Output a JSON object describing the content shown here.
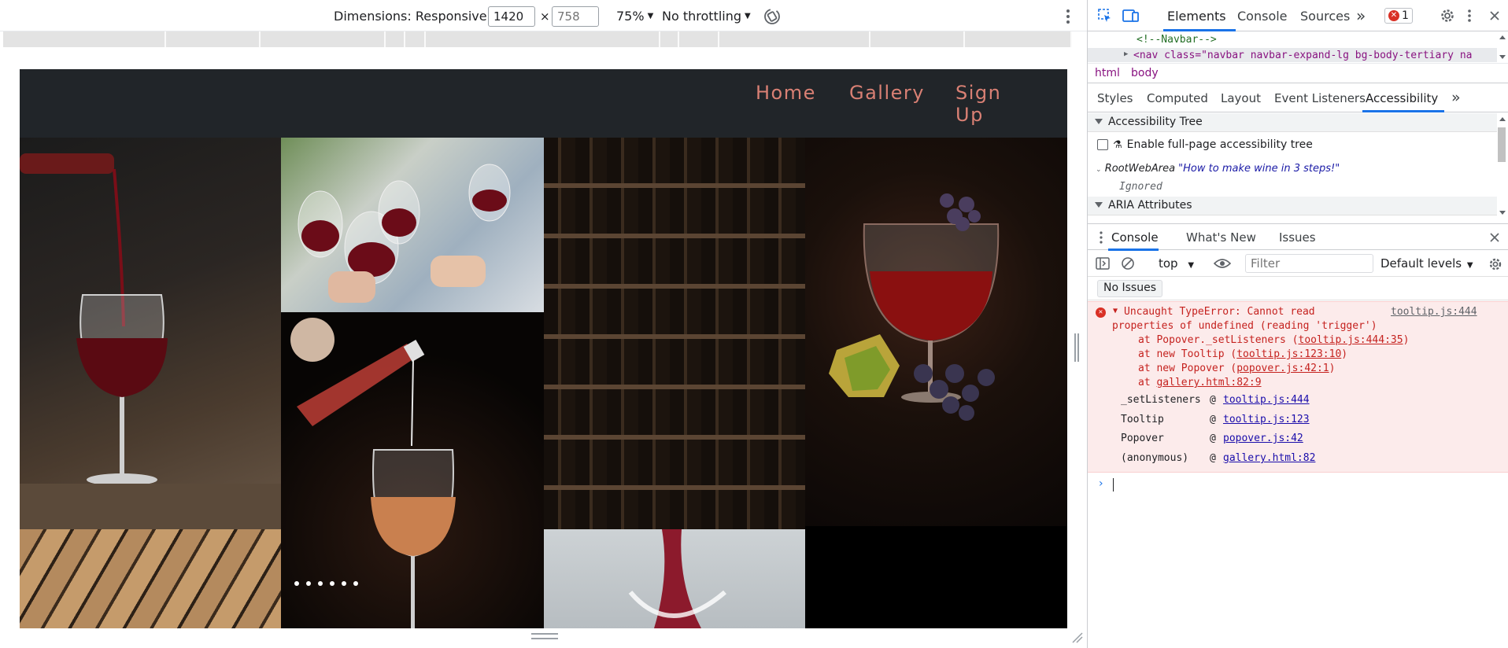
{
  "device_toolbar": {
    "dimensions_label": "Dimensions: Responsive",
    "width_value": "1420",
    "height_placeholder": "758",
    "times": "×",
    "zoom": "75%",
    "throttling": "No throttling"
  },
  "site": {
    "nav": {
      "home": "Home",
      "gallery": "Gallery",
      "signup": "Sign Up"
    },
    "gallery_images": [
      "wine-pour",
      "wine-toast",
      "wine-shelf",
      "wine-grapes",
      "rose-pour",
      "corks",
      "wine-splash"
    ]
  },
  "devtools": {
    "tabs": [
      "Elements",
      "Console",
      "Sources"
    ],
    "more_tabs": "»",
    "error_count": "1",
    "code": {
      "comment": "<!--Navbar-->",
      "nav_tag": "<nav class=\"navbar navbar-expand-lg bg-body-tertiary na"
    },
    "breadcrumbs": [
      "html",
      "body"
    ],
    "sub_tabs": [
      "Styles",
      "Computed",
      "Layout",
      "Event Listeners",
      "Accessibility"
    ],
    "accessibility": {
      "tree_header": "Accessibility Tree",
      "enable_label": "Enable full-page accessibility tree",
      "root_role": "RootWebArea",
      "root_name": "\"How to make wine in 3 steps!\"",
      "ignored": "Ignored",
      "aria_header": "ARIA Attributes"
    },
    "drawer_tabs": [
      "Console",
      "What's New",
      "Issues"
    ],
    "console_toolbar": {
      "context": "top",
      "filter_placeholder": "Filter",
      "levels": "Default levels"
    },
    "no_issues": "No Issues",
    "error": {
      "line1": "Uncaught TypeError: Cannot read",
      "line1_source": "tooltip.js:444",
      "line2": "properties of undefined (reading 'trigger')",
      "frames": [
        {
          "prefix": "at Popover._setListeners (",
          "link": "tooltip.js:444:35",
          "suffix": ")"
        },
        {
          "prefix": "at new Tooltip (",
          "link": "tooltip.js:123:10",
          "suffix": ")"
        },
        {
          "prefix": "at new Popover (",
          "link": "popover.js:42:1",
          "suffix": ")"
        },
        {
          "prefix": "at ",
          "link": "gallery.html:82:9",
          "suffix": ""
        }
      ],
      "stack": [
        {
          "fn": "_setListeners",
          "at": "@",
          "link": "tooltip.js:444"
        },
        {
          "fn": "Tooltip",
          "at": "@",
          "link": "tooltip.js:123"
        },
        {
          "fn": "Popover",
          "at": "@",
          "link": "popover.js:42"
        },
        {
          "fn": "(anonymous)",
          "at": "@",
          "link": "gallery.html:82"
        }
      ]
    },
    "prompt": "›"
  },
  "colors": {
    "accent": "#1a73e8",
    "error": "#d93025",
    "nav_link": "#d98074",
    "navbar_bg": "#212529"
  }
}
